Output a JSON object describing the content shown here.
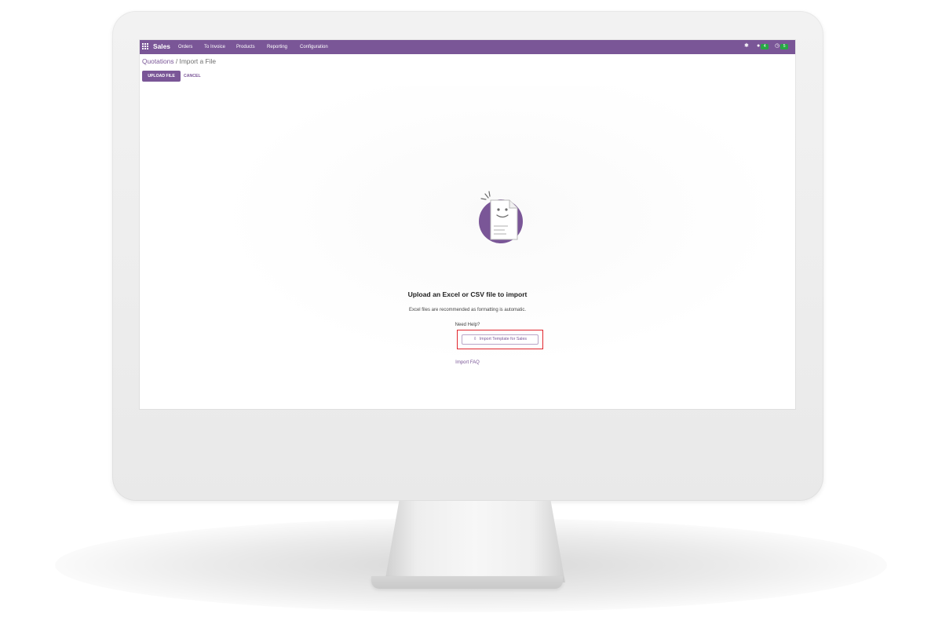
{
  "navbar": {
    "brand": "Sales",
    "menu": [
      "Orders",
      "To Invoice",
      "Products",
      "Reporting",
      "Configuration"
    ],
    "badges": {
      "messages": "4",
      "activities": "5"
    },
    "icons": {
      "apps": "apps-grid-icon",
      "bug": "bug-icon",
      "chat": "chat-icon",
      "clock": "clock-icon"
    }
  },
  "breadcrumb": {
    "parent": "Quotations",
    "separator": "/",
    "current": "Import a File"
  },
  "actions": {
    "upload": "UPLOAD FILE",
    "cancel": "CANCEL"
  },
  "main": {
    "title": "Upload an Excel or CSV file to import",
    "subtitle": "Excel files are recommended as formatting is automatic.",
    "help": "Need Help?",
    "template_button": "Import Template for Sales",
    "faq": "Import FAQ"
  },
  "colors": {
    "brand": "#7A5697",
    "highlight": "#E1262D",
    "badge": "#28A745"
  }
}
